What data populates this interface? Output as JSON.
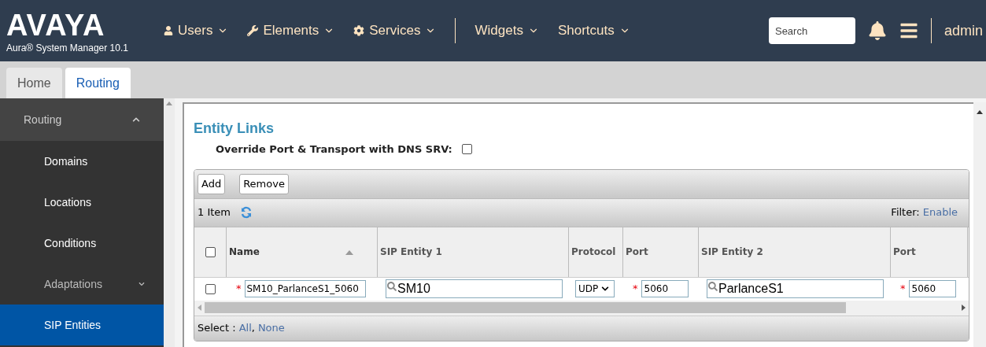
{
  "header": {
    "logo": "AVAYA",
    "subtitle": "Aura® System Manager 10.1",
    "nav": [
      {
        "label": "Users",
        "kind": "user"
      },
      {
        "label": "Elements",
        "kind": "tool"
      },
      {
        "label": "Services",
        "kind": "service"
      },
      {
        "label": "Widgets",
        "kind": "plain"
      },
      {
        "label": "Shortcuts",
        "kind": "plain"
      }
    ],
    "search": {
      "placeholder": "Search"
    },
    "user": "admin"
  },
  "tabs": [
    {
      "label": "Home",
      "selected": false
    },
    {
      "label": "Routing",
      "selected": true
    }
  ],
  "sidebar": {
    "group": {
      "label": "Routing",
      "expanded": true
    },
    "items": [
      {
        "label": "Domains",
        "kind": "link",
        "selected": false
      },
      {
        "label": "Locations",
        "kind": "link",
        "selected": false
      },
      {
        "label": "Conditions",
        "kind": "link",
        "selected": false
      },
      {
        "label": "Adaptations",
        "kind": "folder",
        "expanded": false,
        "selected": false
      },
      {
        "label": "SIP Entities",
        "kind": "link",
        "selected": true
      }
    ]
  },
  "content": {
    "title": "Entity Links",
    "override": {
      "label": "Override Port & Transport with DNS SRV:",
      "checked": false
    },
    "table": {
      "buttons": [
        "Add",
        "Remove"
      ],
      "count": "1 Item",
      "filter_label": "Filter:",
      "filter_link": "Enable",
      "columns": [
        {
          "label": "Name",
          "sorted": true
        },
        {
          "label": "SIP Entity 1",
          "sorted": false
        },
        {
          "label": "Protocol",
          "sorted": false
        },
        {
          "label": "Port",
          "sorted": false
        },
        {
          "label": "SIP Entity 2",
          "sorted": false
        },
        {
          "label": "Port",
          "sorted": false
        }
      ],
      "header_checked": false,
      "rows": [
        {
          "checked": false,
          "required_mark": "*",
          "name": "SM10_ParlanceS1_5060",
          "entity1": "SM10",
          "protocol": "UDP",
          "port1": "5060",
          "entity2": "ParlanceS1",
          "port2": "5060"
        }
      ],
      "select_label": "Select :",
      "select_links": [
        "All",
        "None"
      ],
      "select_separator": ","
    }
  }
}
